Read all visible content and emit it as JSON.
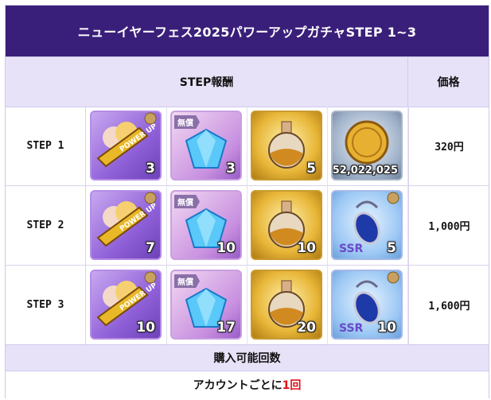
{
  "title": "ニューイヤーフェス2025パワーアップガチャSTEP 1~3",
  "headers": {
    "rewards": "STEP報酬",
    "price": "価格"
  },
  "rows": [
    {
      "step": "STEP 1",
      "price": "320円",
      "items": [
        {
          "icon": "power-up-ticket-icon",
          "count": "3"
        },
        {
          "icon": "free-diamond-icon",
          "tag": "無償",
          "count": "3"
        },
        {
          "icon": "gold-potion-icon",
          "count": "5"
        },
        {
          "icon": "gold-coin-icon",
          "count": "52,022,025"
        }
      ]
    },
    {
      "step": "STEP 2",
      "price": "1,000円",
      "items": [
        {
          "icon": "power-up-ticket-icon",
          "count": "7"
        },
        {
          "icon": "free-diamond-icon",
          "tag": "無償",
          "count": "10"
        },
        {
          "icon": "gold-potion-icon",
          "count": "10"
        },
        {
          "icon": "ssr-amulet-icon",
          "count": "5"
        }
      ]
    },
    {
      "step": "STEP 3",
      "price": "1,600円",
      "items": [
        {
          "icon": "power-up-ticket-icon",
          "count": "10"
        },
        {
          "icon": "free-diamond-icon",
          "tag": "無償",
          "count": "17"
        },
        {
          "icon": "gold-potion-icon",
          "count": "20"
        },
        {
          "icon": "ssr-amulet-icon",
          "count": "10"
        }
      ]
    }
  ],
  "footer": {
    "limit_label": "購入可能回数",
    "limit_prefix": "アカウントごとに",
    "limit_value": "1回"
  },
  "colors": {
    "title_bg": "#3a1f7a",
    "header_bg": "#e8e2f8",
    "accent_red": "#e0101a"
  }
}
